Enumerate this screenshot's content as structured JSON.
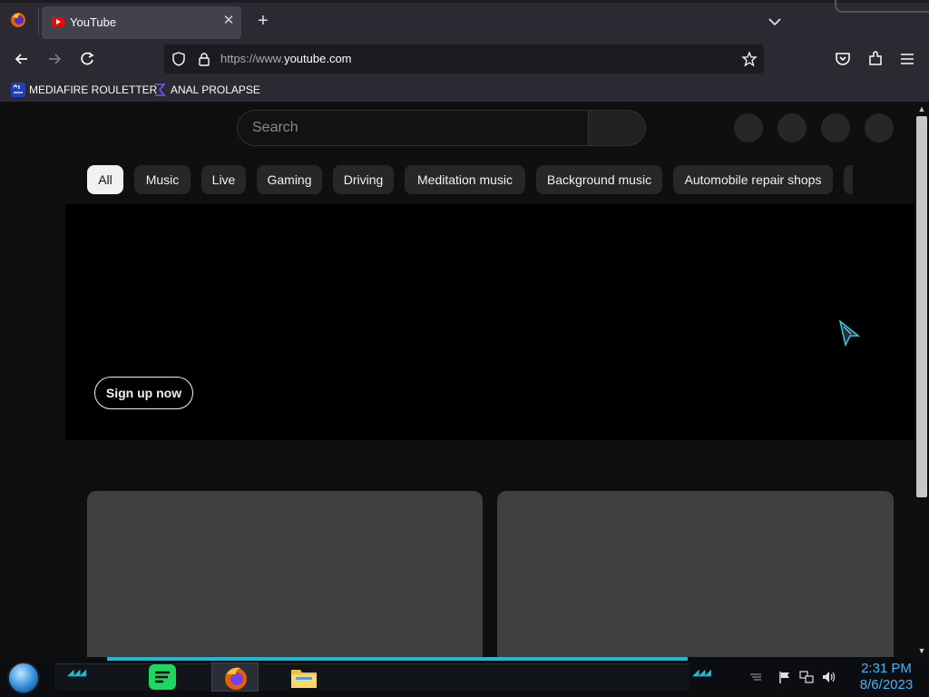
{
  "browser": {
    "tab": {
      "title": "YouTube"
    },
    "url": {
      "prefix": "https://www.",
      "domain": "youtube.com"
    },
    "bookmarks": [
      {
        "label": "MEDIAFIRE ROULETTER"
      },
      {
        "label": "ANAL PROLAPSE"
      }
    ]
  },
  "page": {
    "search": {
      "placeholder": "Search"
    },
    "chips": [
      "All",
      "Music",
      "Live",
      "Gaming",
      "Driving",
      "Meditation music",
      "Background music",
      "Automobile repair shops"
    ],
    "active_chip": "All",
    "banner": {
      "cta_label": "Sign up now"
    }
  },
  "taskbar": {
    "clock": {
      "time": "2:31 PM",
      "date": "8/6/2023"
    }
  },
  "colors": {
    "accent": "#1fb7d6",
    "youtube_red": "#ff0000",
    "clock": "#3fb6ff"
  }
}
